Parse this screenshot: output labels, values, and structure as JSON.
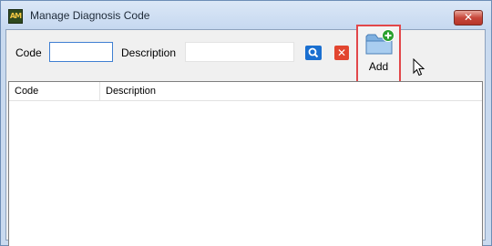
{
  "window": {
    "title": "Manage Diagnosis Code",
    "app_icon_text": "AM",
    "close_symbol": "✕"
  },
  "filters": {
    "code_label": "Code",
    "code_value": "",
    "description_label": "Description",
    "description_value": ""
  },
  "toolbar": {
    "search_icon": "search-icon",
    "clear_symbol": "✕",
    "add_label": "Add"
  },
  "grid": {
    "columns": [
      "Code",
      "Description"
    ],
    "rows": []
  },
  "colors": {
    "titlebar": "#c9daef",
    "close": "#c7473a",
    "search": "#1a6fd0",
    "clear": "#e2452f",
    "highlight": "#e2474a"
  }
}
